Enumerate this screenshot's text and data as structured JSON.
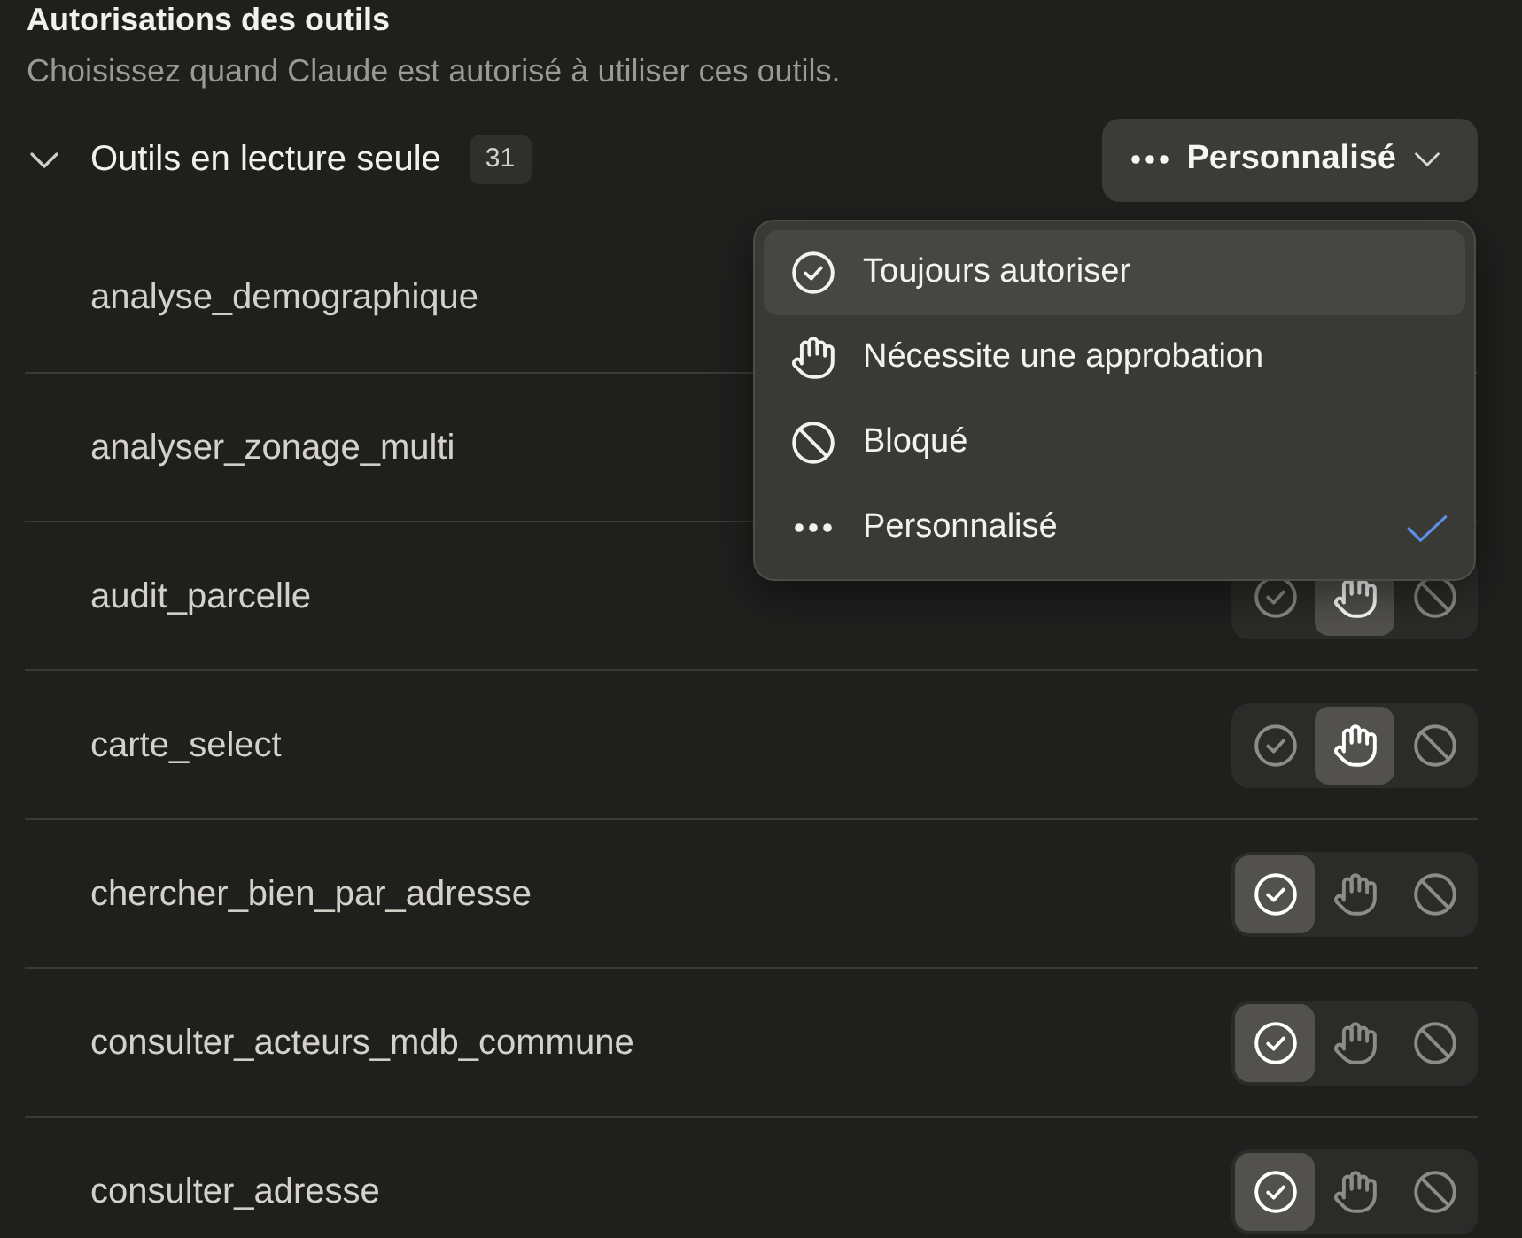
{
  "section": {
    "title": "Autorisations des outils",
    "description": "Choisissez quand Claude est autorisé à utiliser ces outils."
  },
  "group": {
    "title": "Outils en lecture seule",
    "count": "31",
    "expanded": true
  },
  "mode_button": {
    "kind": "custom",
    "label": "Personnalisé"
  },
  "menu": {
    "items": [
      {
        "kind": "allow",
        "label": "Toujours autoriser",
        "highlighted": true,
        "selected": false
      },
      {
        "kind": "approve",
        "label": "Nécessite une approbation",
        "highlighted": false,
        "selected": false
      },
      {
        "kind": "block",
        "label": "Bloqué",
        "highlighted": false,
        "selected": false
      },
      {
        "kind": "custom",
        "label": "Personnalisé",
        "highlighted": false,
        "selected": true
      }
    ]
  },
  "tools": [
    {
      "name": "analyse_demographique"
    },
    {
      "name": "analyser_zonage_multi"
    },
    {
      "name": "audit_parcelle",
      "options": [
        {
          "kind": "allow",
          "selected": false
        },
        {
          "kind": "approve",
          "selected": true
        },
        {
          "kind": "block",
          "selected": false
        }
      ]
    },
    {
      "name": "carte_select",
      "options": [
        {
          "kind": "allow",
          "selected": false
        },
        {
          "kind": "approve",
          "selected": true
        },
        {
          "kind": "block",
          "selected": false
        }
      ]
    },
    {
      "name": "chercher_bien_par_adresse",
      "options": [
        {
          "kind": "allow",
          "selected": true
        },
        {
          "kind": "approve",
          "selected": false
        },
        {
          "kind": "block",
          "selected": false
        }
      ]
    },
    {
      "name": "consulter_acteurs_mdb_commune",
      "options": [
        {
          "kind": "allow",
          "selected": true
        },
        {
          "kind": "approve",
          "selected": false
        },
        {
          "kind": "block",
          "selected": false
        }
      ]
    },
    {
      "name": "consulter_adresse",
      "options": [
        {
          "kind": "allow",
          "selected": true
        },
        {
          "kind": "approve",
          "selected": false
        },
        {
          "kind": "block",
          "selected": false
        }
      ]
    }
  ]
}
